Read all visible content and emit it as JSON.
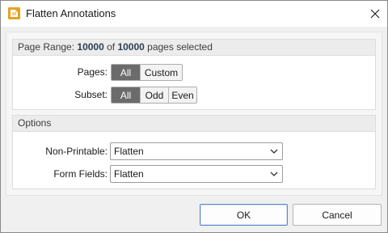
{
  "window": {
    "title": "Flatten Annotations"
  },
  "icons": {
    "app": "app-icon",
    "close": "close-icon",
    "chevron": "chevron-down-icon"
  },
  "page_range": {
    "label_prefix": "Page Range: ",
    "selected_count": "10000",
    "of_word": " of ",
    "total_count": "10000",
    "suffix": " pages selected",
    "pages_label": "Pages:",
    "pages_options": [
      "All",
      "Custom"
    ],
    "pages_selected": "All",
    "subset_label": "Subset:",
    "subset_options": [
      "All",
      "Odd",
      "Even"
    ],
    "subset_selected": "All"
  },
  "options": {
    "header": "Options",
    "non_printable_label": "Non-Printable:",
    "non_printable_value": "Flatten",
    "form_fields_label": "Form Fields:",
    "form_fields_value": "Flatten"
  },
  "buttons": {
    "ok": "OK",
    "cancel": "Cancel"
  },
  "colors": {
    "app_icon": "#e5a320",
    "active_segment": "#6b6b6b",
    "header_bold": "#2b3e55",
    "primary_border": "#5a86c7"
  }
}
